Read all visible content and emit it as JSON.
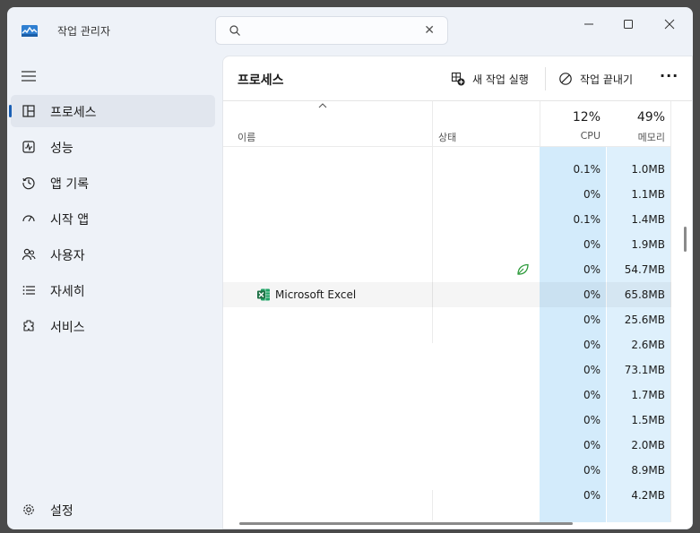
{
  "app": {
    "title": "작업 관리자"
  },
  "search": {
    "value": "",
    "placeholder": ""
  },
  "sidebar": {
    "items": [
      {
        "label": "프로세스",
        "icon": "processes-icon"
      },
      {
        "label": "성능",
        "icon": "performance-icon"
      },
      {
        "label": "앱 기록",
        "icon": "app-history-icon"
      },
      {
        "label": "시작 앱",
        "icon": "startup-apps-icon"
      },
      {
        "label": "사용자",
        "icon": "users-icon"
      },
      {
        "label": "자세히",
        "icon": "details-icon"
      },
      {
        "label": "서비스",
        "icon": "services-icon"
      }
    ],
    "settings_label": "설정"
  },
  "main": {
    "title": "프로세스",
    "new_task_label": "새 작업 실행",
    "end_task_label": "작업 끝내기",
    "more_label": "···"
  },
  "table": {
    "columns": {
      "name": "이름",
      "status": "상태",
      "cpu_pct": "12%",
      "cpu": "CPU",
      "mem_pct": "49%",
      "mem": "메모리"
    },
    "rows": [
      {
        "name": "",
        "cpu": "0.1%",
        "mem": "1.0MB"
      },
      {
        "name": "",
        "cpu": "0%",
        "mem": "1.1MB"
      },
      {
        "name": "",
        "cpu": "0.1%",
        "mem": "1.4MB"
      },
      {
        "name": "",
        "cpu": "0%",
        "mem": "1.9MB"
      },
      {
        "name": "",
        "cpu": "0%",
        "mem": "54.7MB",
        "eco": true
      },
      {
        "name": "Microsoft Excel",
        "cpu": "0%",
        "mem": "65.8MB",
        "selected": true
      },
      {
        "name": "",
        "cpu": "0%",
        "mem": "25.6MB"
      },
      {
        "name": "",
        "cpu": "0%",
        "mem": "2.6MB"
      },
      {
        "name": "",
        "cpu": "0%",
        "mem": "73.1MB"
      },
      {
        "name": "",
        "cpu": "0%",
        "mem": "1.7MB"
      },
      {
        "name": "",
        "cpu": "0%",
        "mem": "1.5MB"
      },
      {
        "name": "",
        "cpu": "0%",
        "mem": "2.0MB"
      },
      {
        "name": "",
        "cpu": "0%",
        "mem": "8.9MB"
      },
      {
        "name": "",
        "cpu": "0%",
        "mem": "4.2MB"
      }
    ]
  },
  "colors": {
    "accent": "#1a5fb4",
    "cpu_column": "#d3ebfb",
    "mem_column": "#def0fc",
    "excel_green": "#1e7145",
    "eco_green": "#2e9b3c"
  }
}
